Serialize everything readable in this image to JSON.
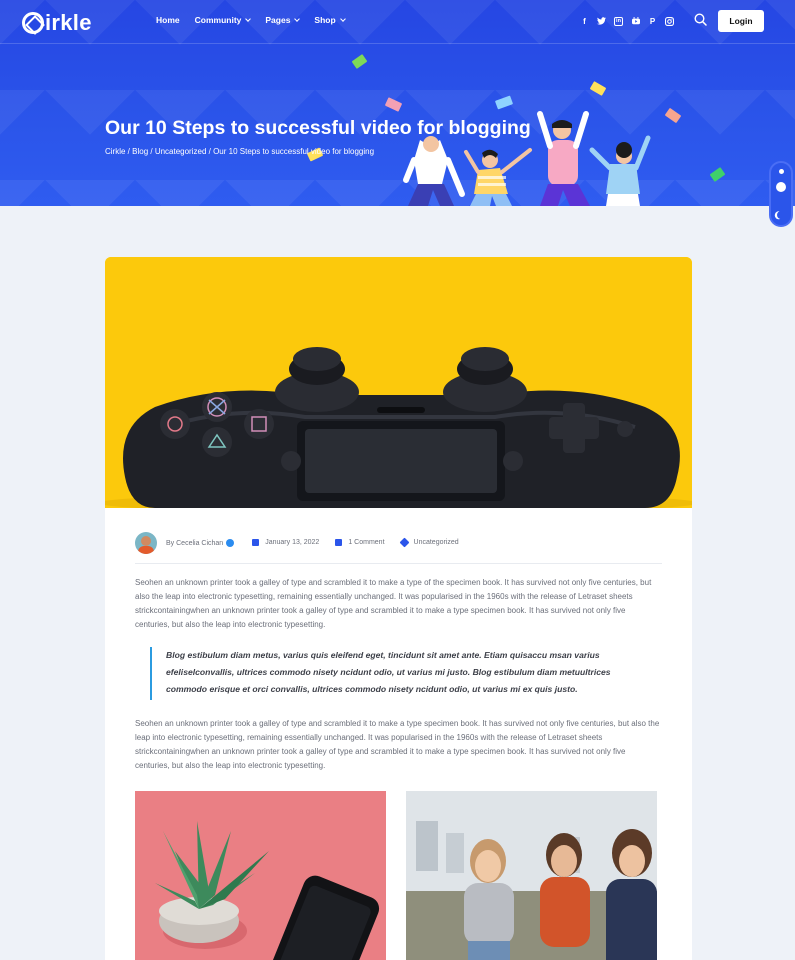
{
  "brand": {
    "logo_text": "irkle"
  },
  "nav": {
    "items": [
      {
        "label": "Home",
        "dropdown": false
      },
      {
        "label": "Community",
        "dropdown": true
      },
      {
        "label": "Pages",
        "dropdown": true
      },
      {
        "label": "Shop",
        "dropdown": true
      }
    ]
  },
  "social": {
    "icons": [
      {
        "name": "facebook-icon",
        "glyph": "f"
      },
      {
        "name": "twitter-icon",
        "glyph": "t"
      },
      {
        "name": "linkedin-icon",
        "glyph": "in"
      },
      {
        "name": "youtube-icon",
        "glyph": "▶"
      },
      {
        "name": "pinterest-icon",
        "glyph": "P"
      },
      {
        "name": "instagram-icon",
        "glyph": "◎"
      }
    ]
  },
  "header": {
    "login_label": "Login"
  },
  "hero": {
    "title": "Our 10 Steps to successful video for blogging",
    "breadcrumb": [
      "Cirkle",
      "Blog",
      "Uncategorized",
      "Our 10 Steps to successful video for blogging"
    ],
    "breadcrumb_sep": " / "
  },
  "post": {
    "author_prefix": "By",
    "author": "Cecelia Cichan",
    "date": "January 13, 2022",
    "comments": "1 Comment",
    "category": "Uncategorized",
    "paragraph1": "Seohen an unknown printer took a galley of type and scrambled it to make a type of the specimen book. It has survived not only five centuries, but also the leap into electronic typesetting, remaining essentially unchanged. It was popularised in the 1960s with the release of Letraset sheets strickcontainingwhen an unknown printer took a galley of type and scrambled it to make a type specimen book. It has survived not only five centuries, but also the leap into electronic typesetting.",
    "quote": "Blog estibulum diam metus, varius quis eleifend eget, tincidunt sit amet ante. Etiam quisaccu msan varius efeliselconvallis, ultrices commodo nisety ncidunt odio, ut varius mi justo. Blog estibulum diam metuultrices commodo erisque et orci convallis, ultrices commodo nisety ncidunt odio, ut varius mi ex quis justo.",
    "paragraph2": "Seohen an unknown printer took a galley of type and scrambled it to make a type specimen book. It has survived not only five centuries, but also the leap into electronic typesetting, remaining essentially unchanged. It was popularised in the 1960s with the release of Letraset sheets strickcontainingwhen an unknown printer took a galley of type and scrambled it to make a type specimen book. It has survived not only five centuries, but also the leap into electronic typesetting."
  },
  "colors": {
    "hero_blue": "#2b55ea",
    "accent_yellow": "#fcc90c",
    "quote_border": "#2b9be0"
  }
}
